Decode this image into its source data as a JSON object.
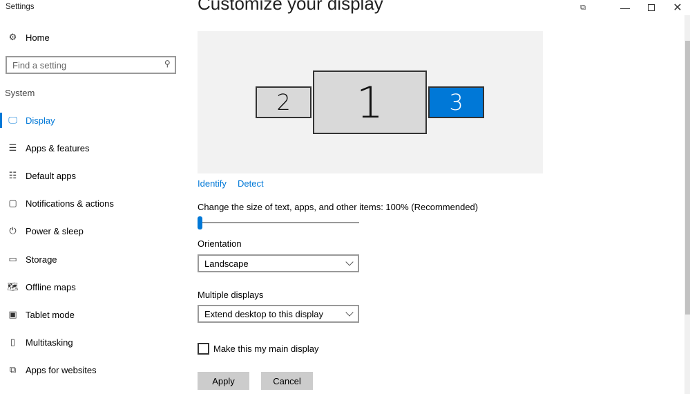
{
  "window": {
    "title": "Settings"
  },
  "sidebar": {
    "home": "Home",
    "search_placeholder": "Find a setting",
    "section": "System",
    "items": [
      {
        "label": "Display",
        "icon": "monitor-icon",
        "active": true
      },
      {
        "label": "Apps & features",
        "icon": "list-icon"
      },
      {
        "label": "Default apps",
        "icon": "default-apps-icon"
      },
      {
        "label": "Notifications & actions",
        "icon": "notification-icon"
      },
      {
        "label": "Power & sleep",
        "icon": "power-icon"
      },
      {
        "label": "Storage",
        "icon": "storage-icon"
      },
      {
        "label": "Offline maps",
        "icon": "map-icon"
      },
      {
        "label": "Tablet mode",
        "icon": "tablet-icon"
      },
      {
        "label": "Multitasking",
        "icon": "multitasking-icon"
      },
      {
        "label": "Apps for websites",
        "icon": "apps-websites-icon"
      }
    ]
  },
  "main": {
    "heading": "Customize your display",
    "monitors": [
      {
        "label": "2",
        "selected": false
      },
      {
        "label": "1",
        "selected": false
      },
      {
        "label": "3",
        "selected": true
      }
    ],
    "identify": "Identify",
    "detect": "Detect",
    "scale_label": "Change the size of text, apps, and other items: 100% (Recommended)",
    "scale_slider_fraction": 0,
    "orientation_label": "Orientation",
    "orientation_value": "Landscape",
    "multiple_label": "Multiple displays",
    "multiple_value": "Extend desktop to this display",
    "main_display_label": "Make this my main display",
    "main_display_checked": false,
    "apply": "Apply",
    "cancel": "Cancel"
  },
  "colors": {
    "accent": "#0078d7"
  }
}
